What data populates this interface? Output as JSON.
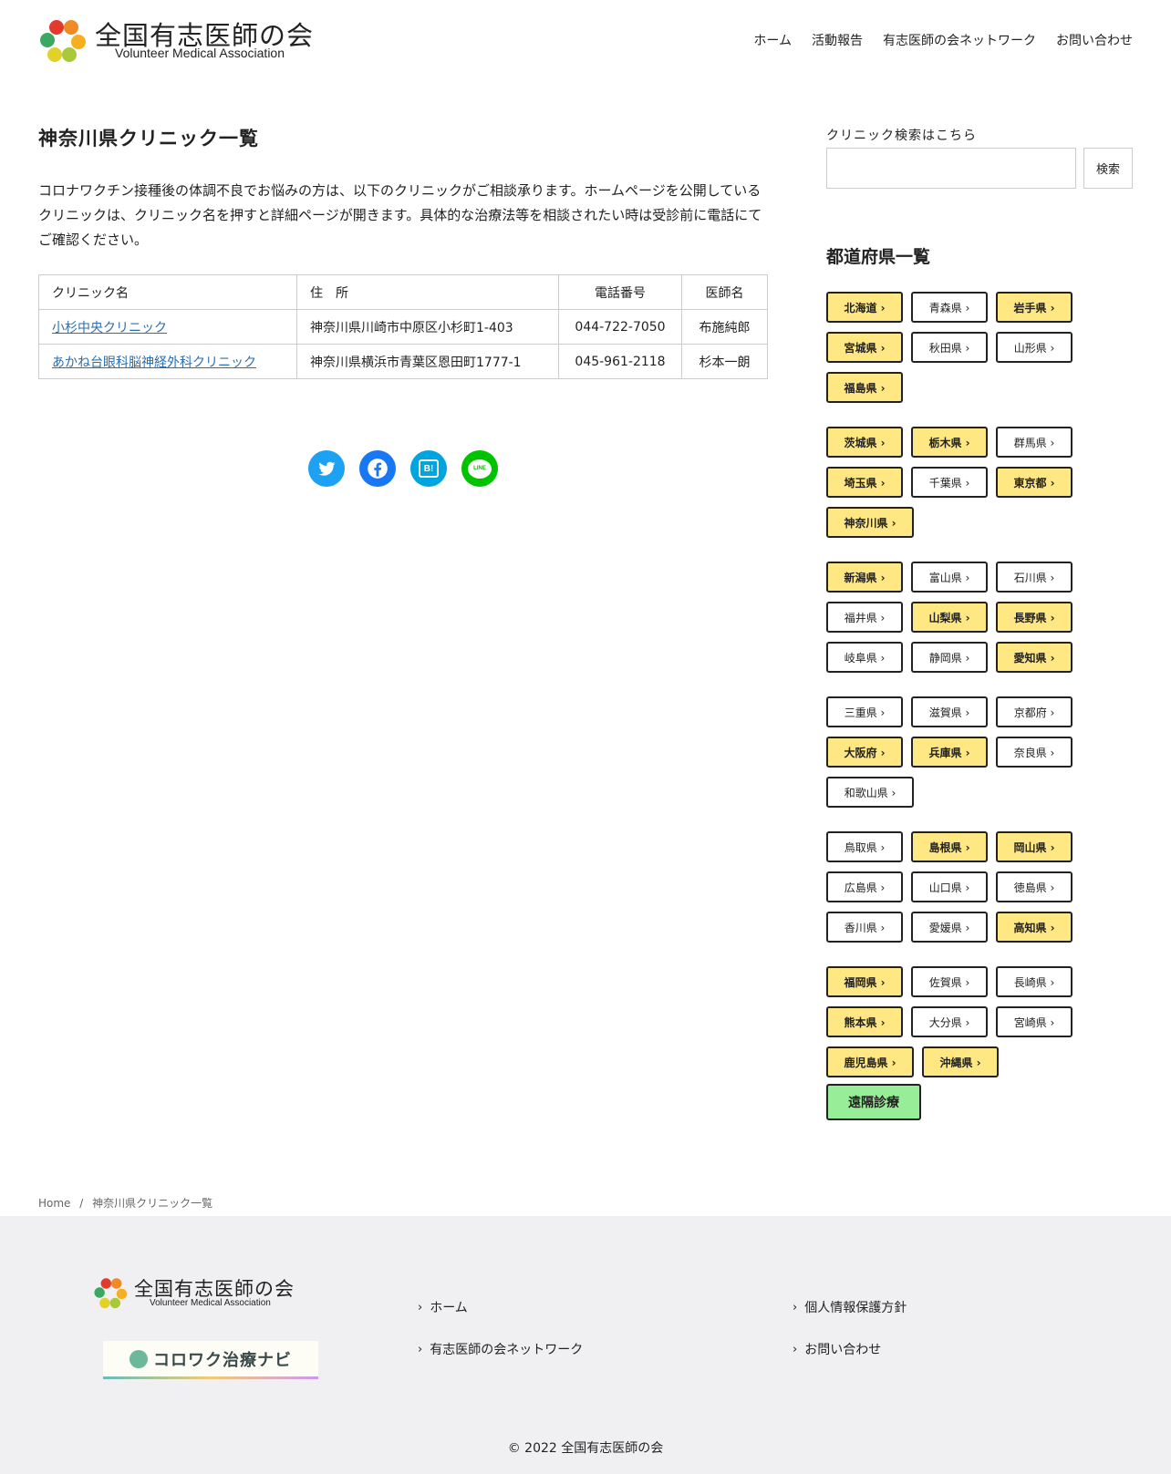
{
  "header": {
    "logo_jp": "全国有志医師の会",
    "logo_en": "Volunteer Medical Association",
    "nav": [
      "ホーム",
      "活動報告",
      "有志医師の会ネットワーク",
      "お問い合わせ"
    ]
  },
  "main": {
    "title": "神奈川県クリニック一覧",
    "lead": "コロナワクチン接種後の体調不良でお悩みの方は、以下のクリニックがご相談承ります。ホームページを公開しているクリニックは、クリニック名を押すと詳細ページが開きます。具体的な治療法等を相談されたい時は受診前に電話にてご確認ください。",
    "table": {
      "headers": [
        "クリニック名",
        "住　所",
        "電話番号",
        "医師名"
      ],
      "rows": [
        [
          "小杉中央クリニック",
          "神奈川県川崎市中原区小杉町1-403",
          "044-722-7050",
          "布施純郎"
        ],
        [
          "あかね台眼科脳神経外科クリニック",
          "神奈川県横浜市青葉区恩田町1777-1",
          "045-961-2118",
          "杉本一朗"
        ]
      ]
    },
    "share": {
      "hatena_label": "B!",
      "line_label": "LINE",
      "colors": {
        "twitter": "#1da1f2",
        "facebook": "#1877f2",
        "hatena": "#00a4de",
        "line": "#00c300"
      }
    }
  },
  "sidebar": {
    "search_label": "クリニック検索はこちら",
    "search_placeholder": "",
    "search_button": "検索",
    "pref_title": "都道府県一覧",
    "regions": [
      [
        [
          "北海道 ›",
          true
        ],
        [
          "青森県 ›",
          false
        ],
        [
          "岩手県 ›",
          true
        ],
        [
          "宮城県 ›",
          true
        ],
        [
          "秋田県 ›",
          false
        ],
        [
          "山形県 ›",
          false
        ],
        [
          "福島県 ›",
          true
        ]
      ],
      [
        [
          "茨城県 ›",
          true
        ],
        [
          "栃木県 ›",
          true
        ],
        [
          "群馬県 ›",
          false
        ],
        [
          "埼玉県 ›",
          true
        ],
        [
          "千葉県 ›",
          false
        ],
        [
          "東京都 ›",
          true
        ],
        [
          "神奈川県 ›",
          true
        ]
      ],
      [
        [
          "新潟県 ›",
          true
        ],
        [
          "富山県 ›",
          false
        ],
        [
          "石川県 ›",
          false
        ],
        [
          "福井県 ›",
          false
        ],
        [
          "山梨県 ›",
          true
        ],
        [
          "長野県 ›",
          true
        ],
        [
          "岐阜県 ›",
          false
        ],
        [
          "静岡県 ›",
          false
        ],
        [
          "愛知県 ›",
          true
        ]
      ],
      [
        [
          "三重県 ›",
          false
        ],
        [
          "滋賀県 ›",
          false
        ],
        [
          "京都府 ›",
          false
        ],
        [
          "大阪府 ›",
          true
        ],
        [
          "兵庫県 ›",
          true
        ],
        [
          "奈良県 ›",
          false
        ],
        [
          "和歌山県 ›",
          false
        ]
      ],
      [
        [
          "鳥取県 ›",
          false
        ],
        [
          "島根県 ›",
          true
        ],
        [
          "岡山県 ›",
          true
        ],
        [
          "広島県 ›",
          false
        ],
        [
          "山口県 ›",
          false
        ],
        [
          "徳島県 ›",
          false
        ],
        [
          "香川県 ›",
          false
        ],
        [
          "愛媛県 ›",
          false
        ],
        [
          "高知県 ›",
          true
        ]
      ],
      [
        [
          "福岡県 ›",
          true
        ],
        [
          "佐賀県 ›",
          false
        ],
        [
          "長崎県 ›",
          false
        ],
        [
          "熊本県 ›",
          true
        ],
        [
          "大分県 ›",
          false
        ],
        [
          "宮崎県 ›",
          false
        ],
        [
          "鹿児島県 ›",
          true
        ],
        [
          "沖縄県 ›",
          true
        ]
      ]
    ],
    "remote_label": "遠隔診療",
    "colors": {
      "highlight": "#ffe783",
      "remote": "#98ee98"
    }
  },
  "breadcrumb": {
    "home": "Home",
    "separator": "/",
    "current": "神奈川県クリニック一覧"
  },
  "footer": {
    "logo_jp": "全国有志医師の会",
    "logo_en": "Volunteer Medical Association",
    "banner_text": "コロワク治療ナビ",
    "links_left": [
      "ホーム",
      "有志医師の会ネットワーク"
    ],
    "links_right": [
      "個人情報保護方針",
      "お問い合わせ"
    ],
    "copyright": "© 2022 全国有志医師の会"
  }
}
